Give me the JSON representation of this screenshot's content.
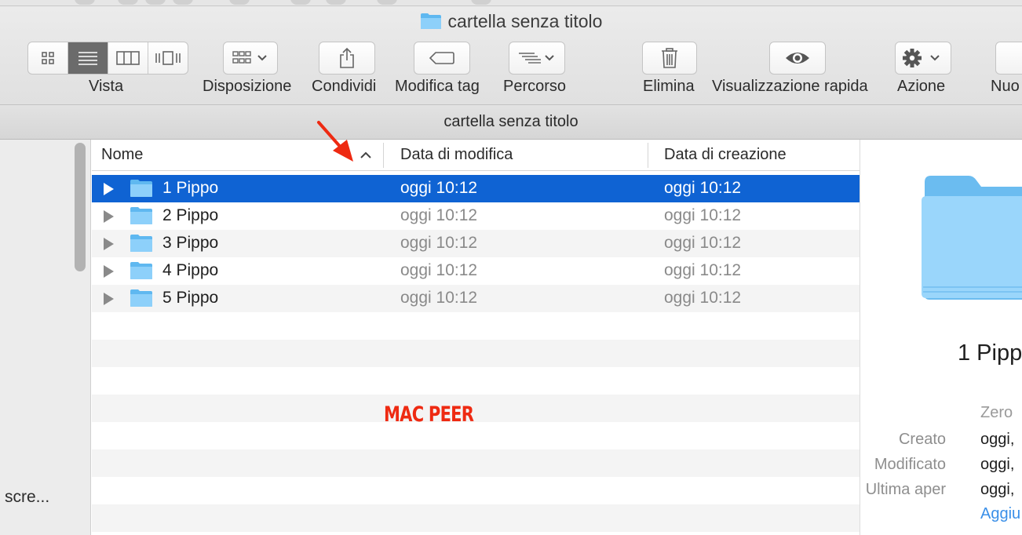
{
  "window": {
    "title": "cartella senza titolo",
    "path_bar": "cartella senza titolo"
  },
  "toolbar": {
    "view_label": "Vista",
    "arrange_label": "Disposizione",
    "share_label": "Condividi",
    "tag_label": "Modifica tag",
    "path_label": "Percorso",
    "delete_label": "Elimina",
    "quicklook_label": "Visualizzazione rapida",
    "action_label": "Azione",
    "new_label": "Nuo"
  },
  "sidebar": {
    "item_label": "scre..."
  },
  "columns": {
    "name": "Nome",
    "modified": "Data di modifica",
    "created": "Data di creazione"
  },
  "rows": [
    {
      "name": "1 Pippo",
      "modified": "oggi 10:12",
      "created": "oggi 10:12"
    },
    {
      "name": "2 Pippo",
      "modified": "oggi 10:12",
      "created": "oggi 10:12"
    },
    {
      "name": "3 Pippo",
      "modified": "oggi 10:12",
      "created": "oggi 10:12"
    },
    {
      "name": "4 Pippo",
      "modified": "oggi 10:12",
      "created": "oggi 10:12"
    },
    {
      "name": "5 Pippo",
      "modified": "oggi 10:12",
      "created": "oggi 10:12"
    }
  ],
  "watermark": "MAC PEER",
  "preview": {
    "name": "1 Pipp",
    "size": "Zero",
    "created_label": "Creato",
    "created_value": "oggi,",
    "modified_label": "Modificato",
    "modified_value": "oggi,",
    "opened_label": "Ultima aper",
    "opened_value": "oggi,",
    "link": "Aggiu"
  },
  "colors": {
    "selection": "#0f63d3",
    "folder": "#5fb8f0",
    "annotation": "#ee2a12",
    "link": "#3a8fe8"
  },
  "icons": [
    "icon-view-icon",
    "list-view-icon",
    "column-view-icon",
    "coverflow-view-icon",
    "arrange-icon",
    "share-icon",
    "tag-icon",
    "path-icon",
    "trash-icon",
    "eye-icon",
    "gear-icon",
    "folder-icon",
    "sort-ascending-icon",
    "disclosure-triangle-icon"
  ]
}
